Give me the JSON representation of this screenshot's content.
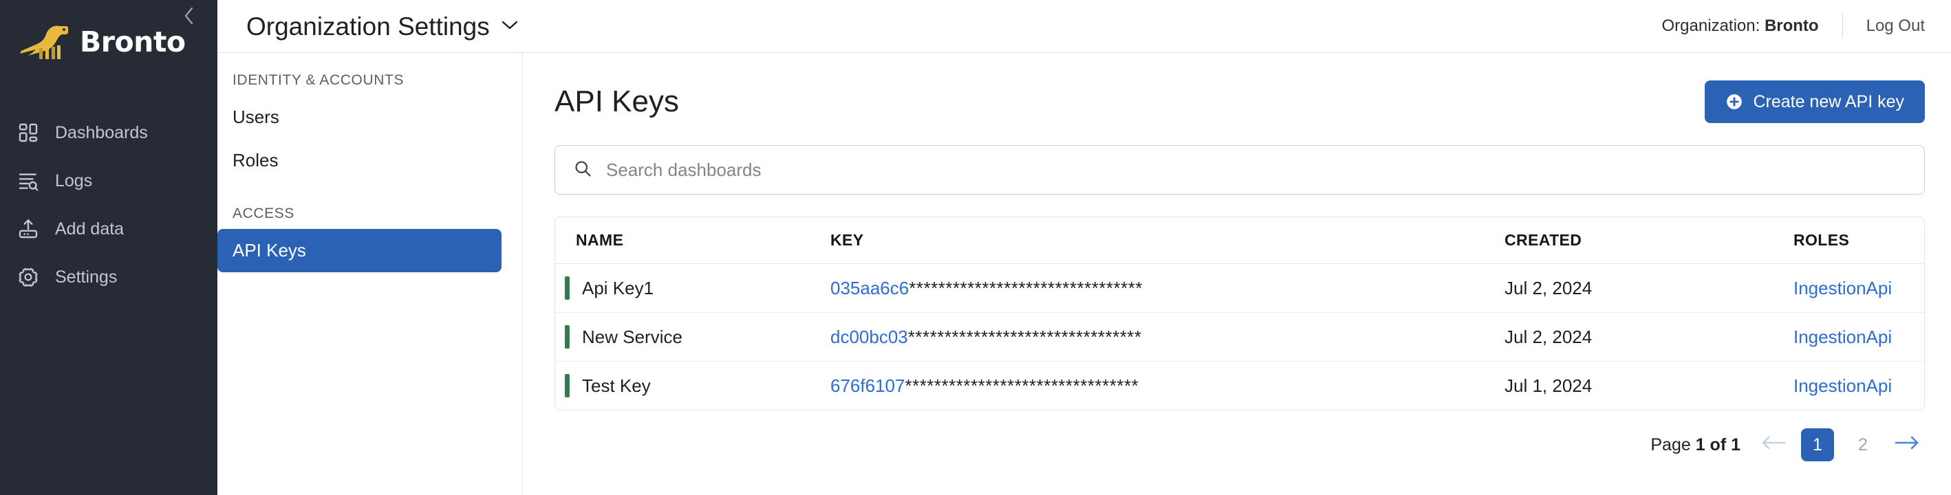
{
  "brand": {
    "name": "Bronto",
    "logo_icon": "brontosaurus-logo-icon",
    "collapse_icon": "chevron-left-icon"
  },
  "nav_rail": {
    "items": [
      {
        "label": "Dashboards",
        "icon": "dashboard-grid-icon"
      },
      {
        "label": "Logs",
        "icon": "logs-search-icon"
      },
      {
        "label": "Add data",
        "icon": "upload-data-icon"
      },
      {
        "label": "Settings",
        "icon": "gear-icon"
      }
    ]
  },
  "topbar": {
    "title": "Organization Settings",
    "title_caret_icon": "chevron-down-icon",
    "org_label": "Organization: ",
    "org_name": "Bronto",
    "logout_label": "Log Out"
  },
  "subnav": {
    "groups": [
      {
        "title": "IDENTITY & ACCOUNTS",
        "items": [
          {
            "label": "Users",
            "active": false
          },
          {
            "label": "Roles",
            "active": false
          }
        ]
      },
      {
        "title": "ACCESS",
        "items": [
          {
            "label": "API Keys",
            "active": true
          }
        ]
      }
    ]
  },
  "main": {
    "page_title": "API Keys",
    "create_button_label": "Create new API key",
    "create_button_icon": "plus-circle-icon",
    "search": {
      "placeholder": "Search dashboards",
      "value": "",
      "icon": "search-icon"
    },
    "table": {
      "columns": [
        "NAME",
        "KEY",
        "CREATED",
        "ROLES"
      ],
      "rows": [
        {
          "name": "Api Key1",
          "key_prefix": "035aa6c6",
          "key_mask": "********************************",
          "created": "Jul 2, 2024",
          "roles": "IngestionApi"
        },
        {
          "name": "New Service",
          "key_prefix": "dc00bc03",
          "key_mask": "********************************",
          "created": "Jul 2, 2024",
          "roles": "IngestionApi"
        },
        {
          "name": "Test Key",
          "key_prefix": "676f6107",
          "key_mask": "********************************",
          "created": "Jul 1, 2024",
          "roles": "IngestionApi"
        }
      ]
    },
    "pagination": {
      "label_prefix": "Page ",
      "label_value": "1 of 1",
      "prev_icon": "arrow-left-icon",
      "next_icon": "arrow-right-icon",
      "pages": [
        {
          "label": "1",
          "active": true
        },
        {
          "label": "2",
          "active": false
        }
      ]
    }
  },
  "colors": {
    "rail_bg": "#262b35",
    "accent_blue": "#2c62b4",
    "link_blue": "#2d6cd4",
    "row_flag_green": "#2f7d53",
    "logo_yellow": "#e8b93f"
  }
}
